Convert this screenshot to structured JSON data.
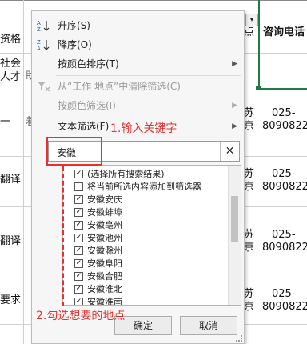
{
  "sheet": {
    "header_left": "资格",
    "header_right": "咨询电话",
    "header_dropdown_glyph": "▾",
    "header_point": "点",
    "row_labels": [
      "社会",
      "人才",
      "一",
      "翻译",
      "翻译",
      "要求"
    ],
    "left_trailing": [
      "助",
      "着"
    ],
    "city_top": [
      "苏",
      "苏",
      "苏",
      "苏"
    ],
    "city_bottom": [
      "京",
      "京",
      "京",
      "京"
    ],
    "phone_top": [
      "025-",
      "025-",
      "025-",
      "025-"
    ],
    "phone_bottom": [
      "8090822",
      "8090822",
      "8090822",
      "8090822"
    ]
  },
  "menu": {
    "sort_asc": "升序(S)",
    "sort_desc": "降序(O)",
    "sort_by_color": "按颜色排序(T)",
    "clear_filter": "从“工作 地点”中清除筛选(C)",
    "filter_by_color": "按颜色筛选(I)",
    "text_filter": "文本筛选(F)"
  },
  "search": {
    "value": "安徽",
    "clear_glyph": "✕"
  },
  "filter_list": {
    "items": [
      {
        "label": "(选择所有搜索结果)",
        "checked": true
      },
      {
        "label": "将当前所选内容添加到筛选器",
        "checked": false
      },
      {
        "label": "安徽安庆",
        "checked": true
      },
      {
        "label": "安徽蚌埠",
        "checked": true
      },
      {
        "label": "安徽亳州",
        "checked": true
      },
      {
        "label": "安徽池州",
        "checked": true
      },
      {
        "label": "安徽滁州",
        "checked": true
      },
      {
        "label": "安徽阜阳",
        "checked": true
      },
      {
        "label": "安徽合肥",
        "checked": true
      },
      {
        "label": "安徽淮北",
        "checked": true
      },
      {
        "label": "安徽淮南",
        "checked": true
      }
    ]
  },
  "buttons": {
    "ok": "确定",
    "cancel": "取消"
  },
  "annotations": {
    "step1": "1.输入关键字",
    "step2": "2.勾选想要的地点",
    "color": "#e8312f"
  },
  "icons": {
    "sort_asc": "sort-ascending-icon",
    "sort_desc": "sort-descending-icon",
    "clear_filter": "clear-filter-icon",
    "submenu": "chevron-right-icon"
  }
}
